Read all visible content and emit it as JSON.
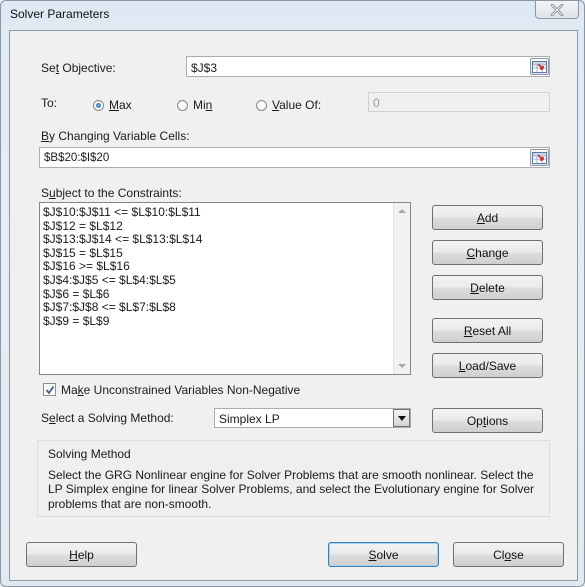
{
  "window": {
    "title": "Solver Parameters",
    "close_icon": "close-icon"
  },
  "objective": {
    "label_pre": "Se",
    "label_key": "t",
    "label_post": " Objective:",
    "value": "$J$3",
    "ref_icon": "range-select-icon"
  },
  "to": {
    "label": "To:",
    "options": [
      {
        "pre": "",
        "key": "M",
        "post": "ax",
        "selected": true
      },
      {
        "pre": "Mi",
        "key": "n",
        "post": "",
        "selected": false
      },
      {
        "pre": "",
        "key": "V",
        "post": "alue Of:",
        "selected": false
      }
    ],
    "value_of": "0"
  },
  "changing_cells": {
    "label_key": "B",
    "label_post": "y Changing Variable Cells:",
    "value": "$B$20:$I$20",
    "ref_icon": "range-select-icon"
  },
  "constraints": {
    "label_pre": "S",
    "label_key": "u",
    "label_post": "bject to the Constraints:",
    "items": [
      "$J$10:$J$11 <= $L$10:$L$11",
      "$J$12 = $L$12",
      "$J$13:$J$14 <= $L$13:$L$14",
      "$J$15 = $L$15",
      "$J$16 >= $L$16",
      "$J$4:$J$5 <= $L$4:$L$5",
      "$J$6 = $L$6",
      "$J$7:$J$8 <= $L$7:$L$8",
      "$J$9 = $L$9"
    ]
  },
  "side_buttons": {
    "add": {
      "key": "A",
      "post": "dd"
    },
    "change": {
      "key": "C",
      "post": "hange"
    },
    "delete": {
      "key": "D",
      "post": "elete"
    },
    "reset": {
      "key": "R",
      "post": "eset All"
    },
    "loadsave": {
      "key": "L",
      "post": "oad/Save"
    }
  },
  "nonneg": {
    "checked": true,
    "label_pre": "Ma",
    "label_key": "k",
    "label_post": "e Unconstrained Variables Non-Negative"
  },
  "method": {
    "label_pre": "S",
    "label_key": "e",
    "label_post": "lect a Solving Method:",
    "selected": "Simplex LP",
    "options_pre": "Op",
    "options_key": "t",
    "options_post": "ions"
  },
  "info": {
    "title": "Solving Method",
    "text": "Select the GRG Nonlinear engine for Solver Problems that are smooth nonlinear. Select the LP Simplex engine for linear Solver Problems, and select the Evolutionary engine for Solver problems that are non-smooth."
  },
  "footer": {
    "help": {
      "key": "H",
      "post": "elp"
    },
    "solve": {
      "key": "S",
      "post": "olve"
    },
    "close": {
      "pre": "Cl",
      "key": "o",
      "post": "se"
    }
  }
}
